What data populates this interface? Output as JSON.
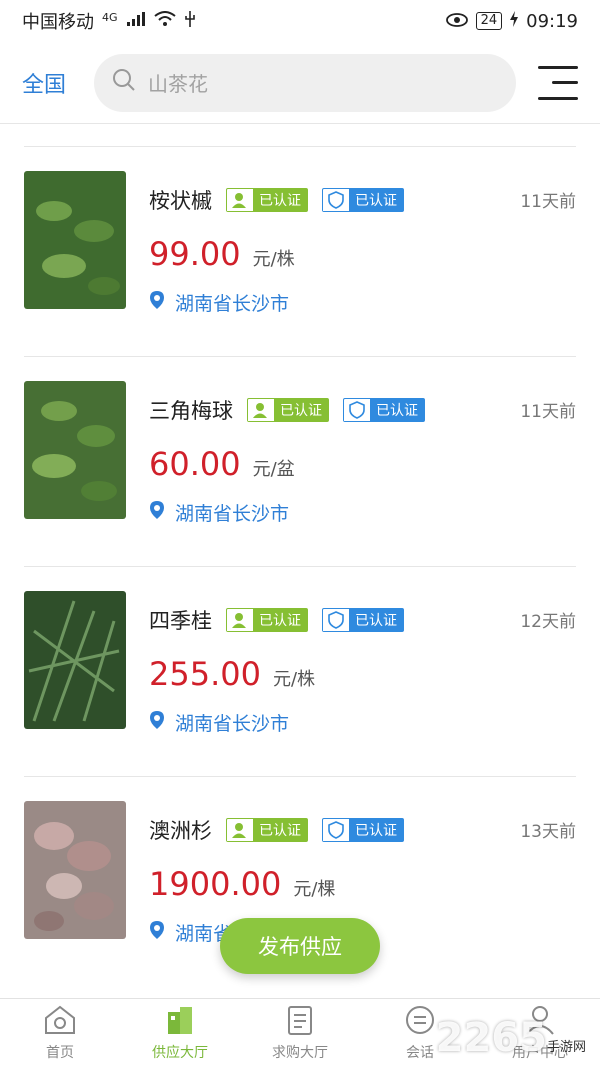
{
  "status_bar": {
    "carrier": "中国移动",
    "network": "4G",
    "battery": "24",
    "time": "09:19"
  },
  "header": {
    "region": "全国",
    "search_placeholder": "山茶花"
  },
  "badge_texts": {
    "personal": "已认证",
    "company": "已认证"
  },
  "items": [
    {
      "name": "桉状槭",
      "time": "11天前",
      "price": "99.00",
      "unit": "元/株",
      "location": "湖南省长沙市",
      "thumb_color": "#3f6b2f"
    },
    {
      "name": "三角梅球",
      "time": "11天前",
      "price": "60.00",
      "unit": "元/盆",
      "location": "湖南省长沙市",
      "thumb_color": "#476f34"
    },
    {
      "name": "四季桂",
      "time": "12天前",
      "price": "255.00",
      "unit": "元/株",
      "location": "湖南省长沙市",
      "thumb_color": "#2f4f2a"
    },
    {
      "name": "澳洲杉",
      "time": "13天前",
      "price": "1900.00",
      "unit": "元/棵",
      "location": "湖南省",
      "thumb_color": "#9a8a86"
    }
  ],
  "fab": {
    "label": "发布供应"
  },
  "tabbar": {
    "tabs": [
      {
        "label": "首页",
        "icon": "home-icon"
      },
      {
        "label": "供应大厅",
        "icon": "supply-icon"
      },
      {
        "label": "求购大厅",
        "icon": "purchase-icon"
      },
      {
        "label": "会话",
        "icon": "chat-icon"
      },
      {
        "label": "用户中心",
        "icon": "user-icon"
      }
    ],
    "active_index": 1
  },
  "watermark": {
    "text": "2265",
    "sub": "手游网"
  },
  "colors": {
    "accent_blue": "#2f7fd6",
    "price_red": "#d0202a",
    "brand_green": "#8cc63f"
  }
}
